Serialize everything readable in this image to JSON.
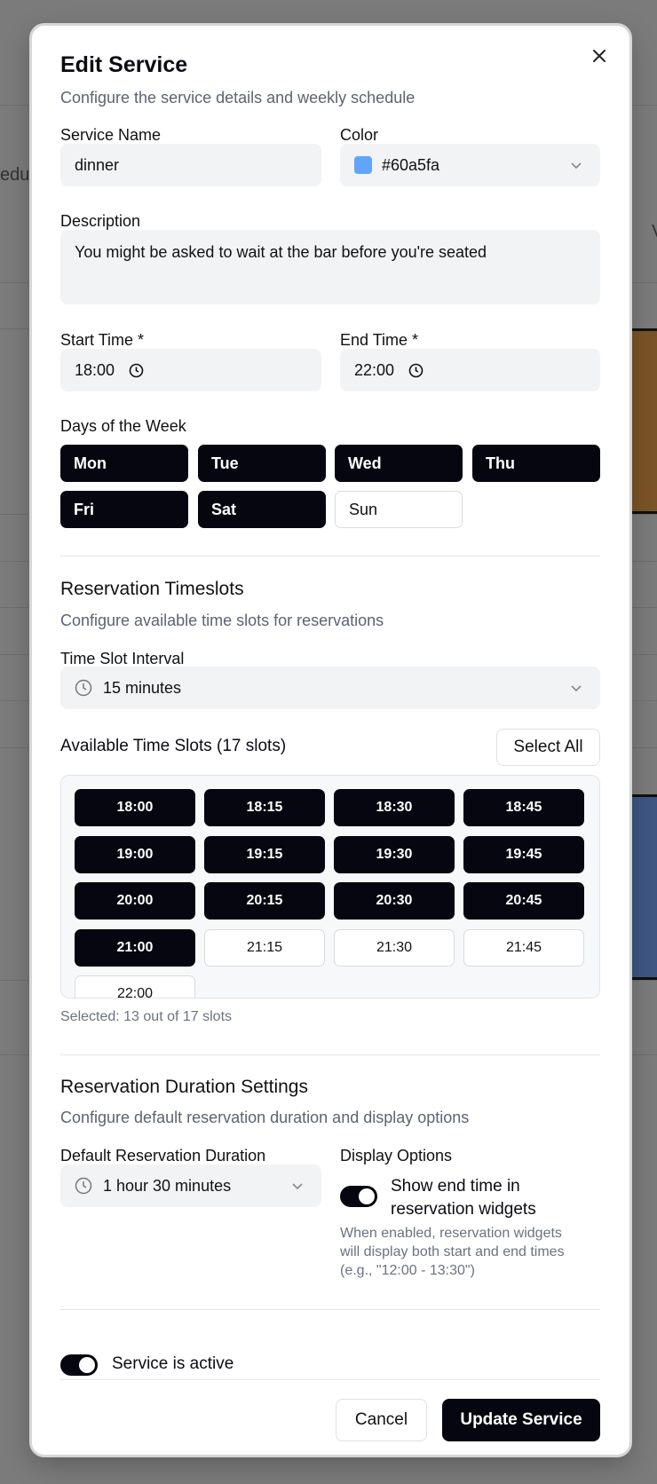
{
  "background": {
    "left_fragment": "edul",
    "right_fragment": "V"
  },
  "dialog": {
    "title": "Edit Service",
    "subtitle": "Configure the service details and weekly schedule"
  },
  "service_name": {
    "label": "Service Name",
    "value": "dinner"
  },
  "color": {
    "label": "Color",
    "value": "#60a5fa",
    "swatch": "#60a5fa"
  },
  "description": {
    "label": "Description",
    "value": "You might be asked to wait at the bar before you're seated"
  },
  "start_time": {
    "label": "Start Time *",
    "value": "18:00"
  },
  "end_time": {
    "label": "End Time *",
    "value": "22:00"
  },
  "days": {
    "label": "Days of the Week",
    "items": [
      {
        "label": "Mon",
        "selected": true
      },
      {
        "label": "Tue",
        "selected": true
      },
      {
        "label": "Wed",
        "selected": true
      },
      {
        "label": "Thu",
        "selected": true
      },
      {
        "label": "Fri",
        "selected": true
      },
      {
        "label": "Sat",
        "selected": true
      },
      {
        "label": "Sun",
        "selected": false
      }
    ]
  },
  "timeslots": {
    "title": "Reservation Timeslots",
    "subtitle": "Configure available time slots for reservations",
    "interval_label": "Time Slot Interval",
    "interval_value": "15 minutes",
    "available_label": "Available Time Slots (17 slots)",
    "select_all": "Select All",
    "slots": [
      {
        "time": "18:00",
        "selected": true
      },
      {
        "time": "18:15",
        "selected": true
      },
      {
        "time": "18:30",
        "selected": true
      },
      {
        "time": "18:45",
        "selected": true
      },
      {
        "time": "19:00",
        "selected": true
      },
      {
        "time": "19:15",
        "selected": true
      },
      {
        "time": "19:30",
        "selected": true
      },
      {
        "time": "19:45",
        "selected": true
      },
      {
        "time": "20:00",
        "selected": true
      },
      {
        "time": "20:15",
        "selected": true
      },
      {
        "time": "20:30",
        "selected": true
      },
      {
        "time": "20:45",
        "selected": true
      },
      {
        "time": "21:00",
        "selected": true
      },
      {
        "time": "21:15",
        "selected": false
      },
      {
        "time": "21:30",
        "selected": false
      },
      {
        "time": "21:45",
        "selected": false
      },
      {
        "time": "22:00",
        "selected": false
      }
    ],
    "selected_summary": "Selected: 13 out of 17 slots"
  },
  "duration": {
    "title": "Reservation Duration Settings",
    "subtitle": "Configure default reservation duration and display options",
    "default_label": "Default Reservation Duration",
    "default_value": "1 hour 30 minutes",
    "display_label": "Display Options",
    "toggle_label_1": "Show end time in",
    "toggle_label_2": "reservation widgets",
    "help_1": "When enabled, reservation widgets",
    "help_2": "will display both start and end times",
    "help_3": "(e.g., \"12:00 - 13:30\")"
  },
  "active": {
    "label": "Service is active",
    "on": true
  },
  "footer": {
    "cancel": "Cancel",
    "submit": "Update Service"
  },
  "colors": {
    "primary": "#05060f",
    "field_bg": "#f2f3f5",
    "muted_text": "#5b6472",
    "backdrop": "#7b7b7b",
    "bg_orange": "#7a5426",
    "bg_blue": "#3f5583"
  }
}
